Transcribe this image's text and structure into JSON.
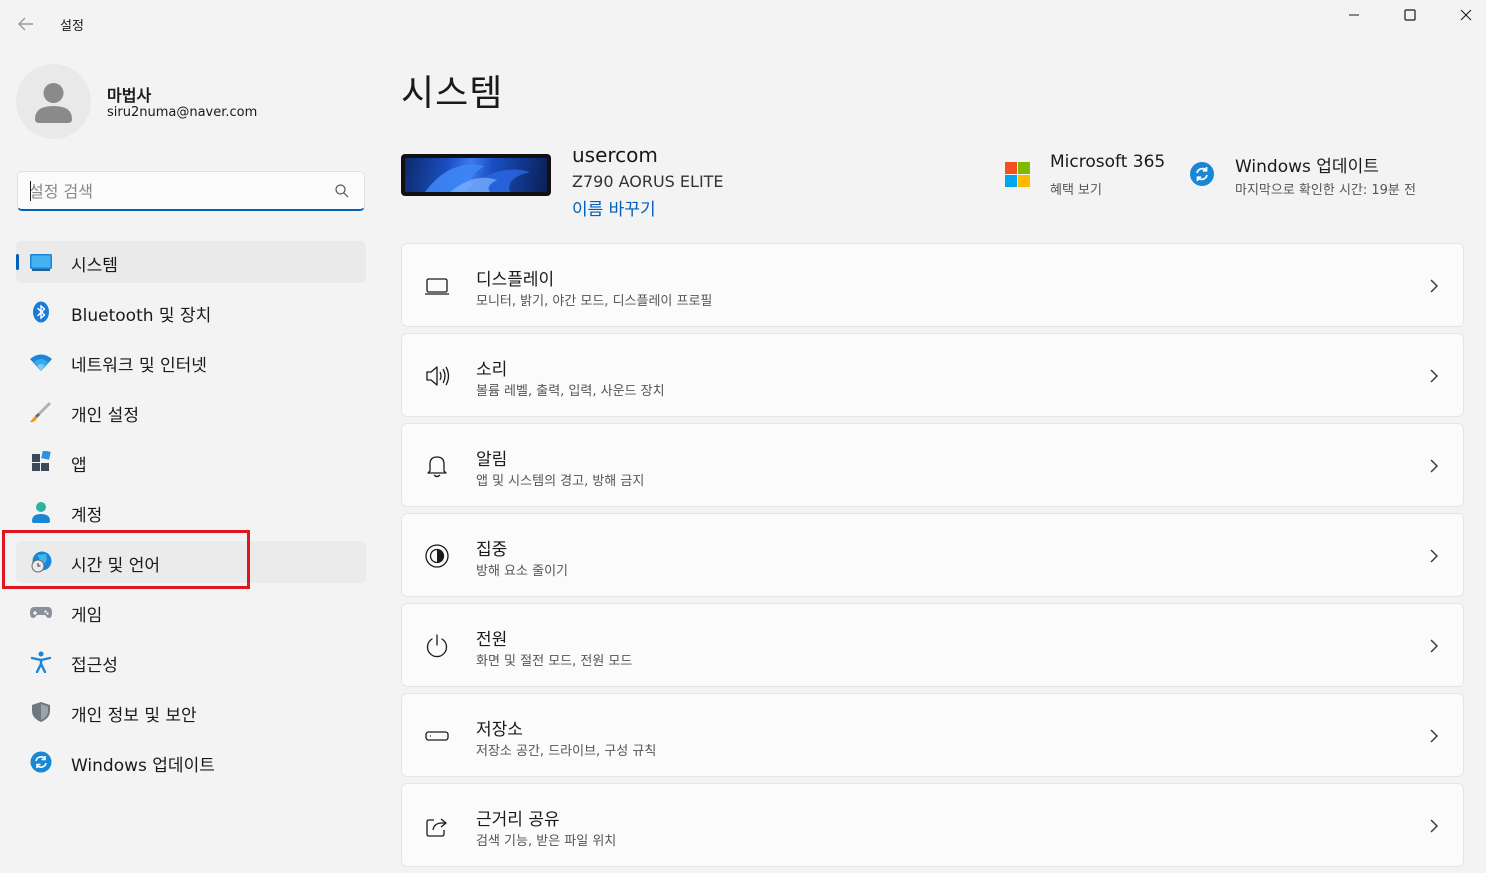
{
  "window": {
    "title": "설정"
  },
  "profile": {
    "name": "마법사",
    "email": "siru2numa@naver.com"
  },
  "search": {
    "placeholder": "설정 검색"
  },
  "nav": {
    "items": [
      {
        "label": "시스템",
        "icon": "system-icon"
      },
      {
        "label": "Bluetooth 및 장치",
        "icon": "bluetooth-icon"
      },
      {
        "label": "네트워크 및 인터넷",
        "icon": "wifi-icon"
      },
      {
        "label": "개인 설정",
        "icon": "brush-icon"
      },
      {
        "label": "앱",
        "icon": "apps-icon"
      },
      {
        "label": "계정",
        "icon": "account-icon"
      },
      {
        "label": "시간 및 언어",
        "icon": "globe-clock-icon"
      },
      {
        "label": "게임",
        "icon": "gamepad-icon"
      },
      {
        "label": "접근성",
        "icon": "accessibility-icon"
      },
      {
        "label": "개인 정보 및 보안",
        "icon": "shield-icon"
      },
      {
        "label": "Windows 업데이트",
        "icon": "update-icon"
      }
    ]
  },
  "main": {
    "title": "시스템",
    "device": {
      "name": "usercom",
      "model": "Z790 AORUS ELITE",
      "rename": "이름 바꾸기"
    },
    "microsoft365": {
      "title": "Microsoft 365",
      "subtitle": "혜택 보기"
    },
    "windows_update": {
      "title": "Windows 업데이트",
      "subtitle": "마지막으로 확인한 시간: 19분 전"
    },
    "cards": [
      {
        "title": "디스플레이",
        "subtitle": "모니터, 밝기, 야간 모드, 디스플레이 프로필",
        "icon": "display-icon"
      },
      {
        "title": "소리",
        "subtitle": "볼륨 레벨, 출력, 입력, 사운드 장치",
        "icon": "speaker-icon"
      },
      {
        "title": "알림",
        "subtitle": "앱 및 시스템의 경고, 방해 금지",
        "icon": "bell-icon"
      },
      {
        "title": "집중",
        "subtitle": "방해 요소 줄이기",
        "icon": "focus-icon"
      },
      {
        "title": "전원",
        "subtitle": "화면 및 절전 모드, 전원 모드",
        "icon": "power-icon"
      },
      {
        "title": "저장소",
        "subtitle": "저장소 공간, 드라이브, 구성 규칙",
        "icon": "storage-icon"
      },
      {
        "title": "근거리 공유",
        "subtitle": "검색 기능, 받은 파일 위치",
        "icon": "share-icon"
      }
    ]
  },
  "colors": {
    "accent": "#005fb8",
    "highlight": "#e0161e",
    "background": "#f3f3f3"
  }
}
